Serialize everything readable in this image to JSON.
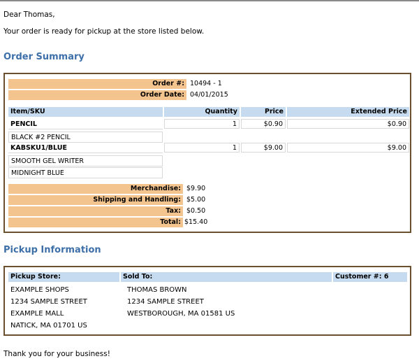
{
  "greeting": "Dear Thomas,",
  "intro": "Your order is ready for pickup at the store listed below.",
  "order_summary": {
    "heading": "Order Summary",
    "order_number_label": "Order #:",
    "order_number": "10494 - 1",
    "order_date_label": "Order Date:",
    "order_date": "04/01/2015",
    "columns": [
      "Item/SKU",
      "Quantity",
      "Price",
      "Extended Price"
    ],
    "items": [
      {
        "sku": "PENCIL",
        "quantity": "1",
        "price": "$0.90",
        "extended": "$0.90",
        "details": [
          "BLACK #2 PENCIL"
        ]
      },
      {
        "sku": "KABSKU1/BLUE",
        "quantity": "1",
        "price": "$9.00",
        "extended": "$9.00",
        "details": [
          "SMOOTH GEL WRITER",
          "MIDNIGHT BLUE"
        ]
      }
    ],
    "merchandise_label": "Merchandise:",
    "merchandise": "$9.90",
    "shipping_label": "Shipping and Handling:",
    "shipping": "$5.00",
    "tax_label": "Tax:",
    "tax": "$0.50",
    "total_label": "Total:",
    "total": "$15.40"
  },
  "pickup": {
    "heading": "Pickup Information",
    "store_label": "Pickup Store:",
    "sold_to_label": "Sold To:",
    "customer_label": "Customer #: 6",
    "store_lines": [
      "EXAMPLE SHOPS",
      "1234 SAMPLE STREET",
      "EXAMPLE MALL",
      "NATICK, MA 01701 US"
    ],
    "sold_to_lines": [
      "THOMAS BROWN",
      "1234 SAMPLE STREET",
      "WESTBOROUGH, MA 01581 US"
    ]
  },
  "closing": "Thank you for your business!",
  "colors": {
    "heading": "#3d6fa8",
    "peach": "#f3c48e",
    "header_blue": "#c6dbef",
    "border": "#6b5030"
  }
}
